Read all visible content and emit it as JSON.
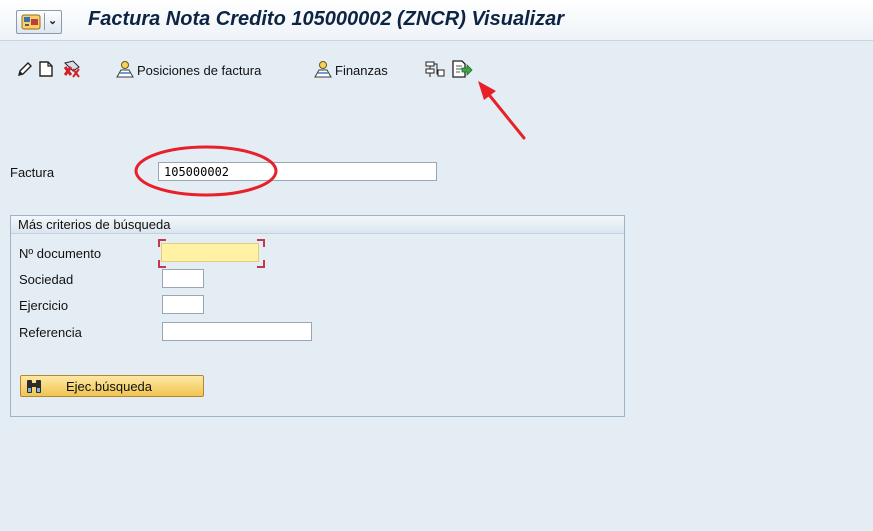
{
  "window": {
    "title": "Factura Nota Credito 105000002  (ZNCR) Visualizar"
  },
  "toolbar": {
    "buttons": [
      {
        "icon": "pencil-icon",
        "label": ""
      },
      {
        "icon": "new-document-icon",
        "label": ""
      },
      {
        "icon": "cancel-document-icon",
        "label": ""
      },
      {
        "icon": "person-icon",
        "label": "Posiciones de factura"
      },
      {
        "icon": "person-icon",
        "label": "Finanzas"
      },
      {
        "icon": "hierarchy-icon",
        "label": ""
      },
      {
        "icon": "output-icon",
        "label": ""
      }
    ]
  },
  "form": {
    "invoice_label": "Factura",
    "invoice_value": "105000002"
  },
  "search_group": {
    "title": "Más criterios de búsqueda",
    "fields": [
      {
        "label": "Nº documento",
        "value": ""
      },
      {
        "label": "Sociedad",
        "value": ""
      },
      {
        "label": "Ejercicio",
        "value": ""
      },
      {
        "label": "Referencia",
        "value": ""
      }
    ],
    "search_button_label": "Ejec.búsqueda"
  },
  "annotations": {
    "circle_color": "#e8202a",
    "arrow_color": "#e8202a"
  }
}
